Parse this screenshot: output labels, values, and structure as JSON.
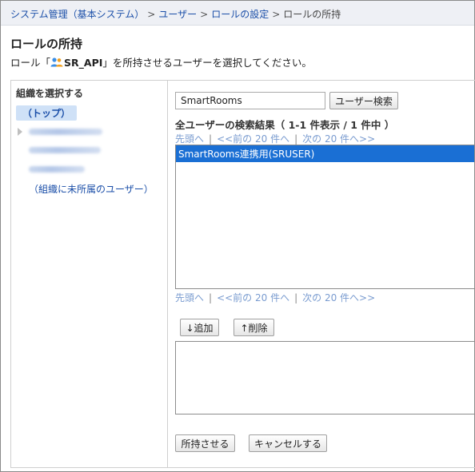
{
  "breadcrumb": {
    "items": [
      "システム管理（基本システム）",
      "ユーザー",
      "ロールの設定"
    ],
    "current": "ロールの所持",
    "separator": ">"
  },
  "page": {
    "title": "ロールの所持",
    "desc_prefix": "ロール「",
    "role_name": "SR_API",
    "desc_suffix": "」を所持させるユーザーを選択してください。"
  },
  "org": {
    "heading": "組織を選択する",
    "top": "（トップ）",
    "unassigned": "（組織に未所属のユーザー）"
  },
  "search": {
    "value": "SmartRooms",
    "button": "ユーザー検索"
  },
  "results": {
    "heading": "全ユーザーの検索結果（ 1-1 件表示 / 1 件中 ）",
    "pager": {
      "first": "先頭へ",
      "prev": "<<前の 20 件へ",
      "next": "次の 20 件へ>>",
      "pipe": "|"
    },
    "items": [
      "SmartRooms連携用(SRUSER)"
    ]
  },
  "actions": {
    "add": "↓追加",
    "remove": "↑削除",
    "submit": "所持させる",
    "cancel": "キャンセルする"
  },
  "colors": {
    "link": "#1a4ea8",
    "selected_bg": "#1a6fd4",
    "pager": "#7a9cd0"
  }
}
